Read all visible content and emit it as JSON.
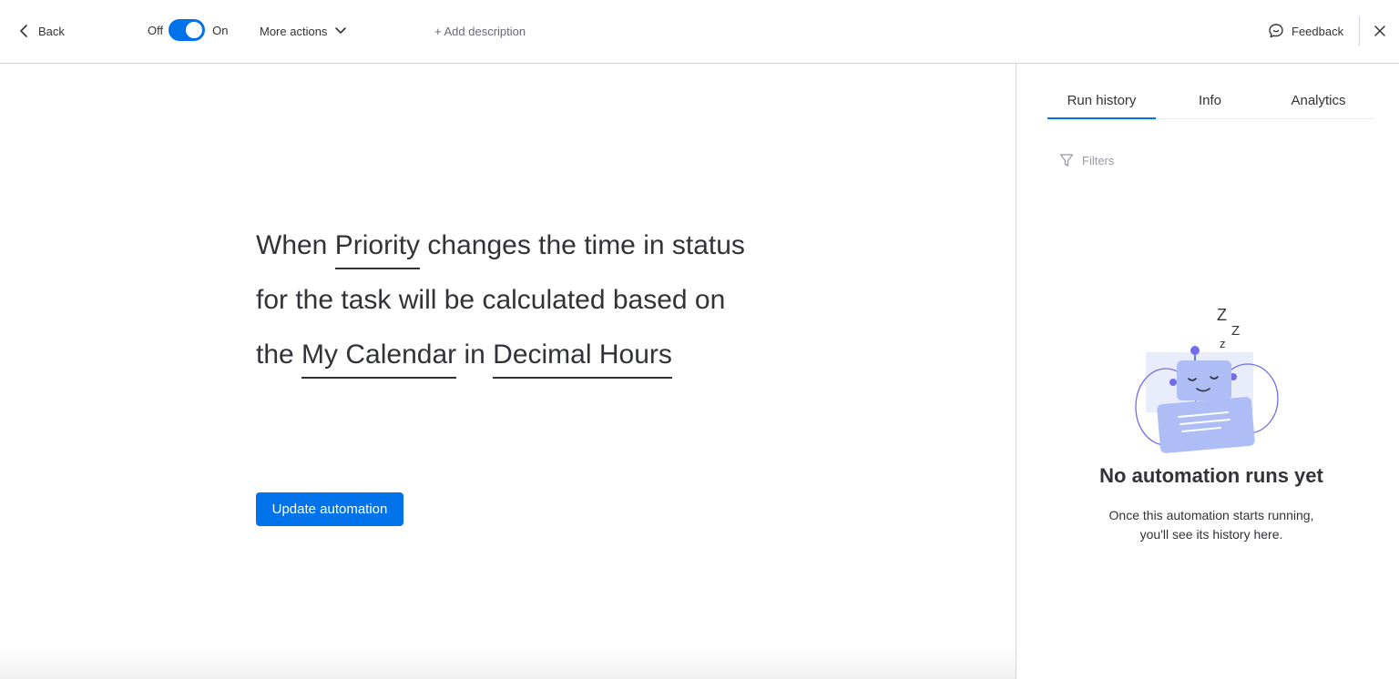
{
  "header": {
    "back_label": "Back",
    "toggle_off_label": "Off",
    "toggle_on_label": "On",
    "toggle_state": "on",
    "more_actions_label": "More actions",
    "add_description_label": "+ Add description",
    "feedback_label": "Feedback"
  },
  "recipe": {
    "part1": "When ",
    "field_priority": "Priority",
    "part2": " changes the time in status for the task will be calculated based on the ",
    "field_calendar": "My Calendar",
    "part3": " in ",
    "field_unit": "Decimal Hours"
  },
  "actions": {
    "update_label": "Update automation"
  },
  "panel": {
    "tabs": [
      {
        "label": "Run history",
        "active": true
      },
      {
        "label": "Info",
        "active": false
      },
      {
        "label": "Analytics",
        "active": false
      }
    ],
    "filters_label": "Filters",
    "empty_title": "No automation runs yet",
    "empty_line1": "Once this automation starts running,",
    "empty_line2": "you'll see its history here."
  },
  "colors": {
    "accent": "#0073ea",
    "text": "#323338",
    "border": "#d0d4e4",
    "illustration": "#6e6ee8"
  },
  "icons": [
    "chevron-left-icon",
    "chevron-down-icon",
    "feedback-icon",
    "close-icon",
    "filter-icon",
    "sleeping-robot-illustration"
  ]
}
